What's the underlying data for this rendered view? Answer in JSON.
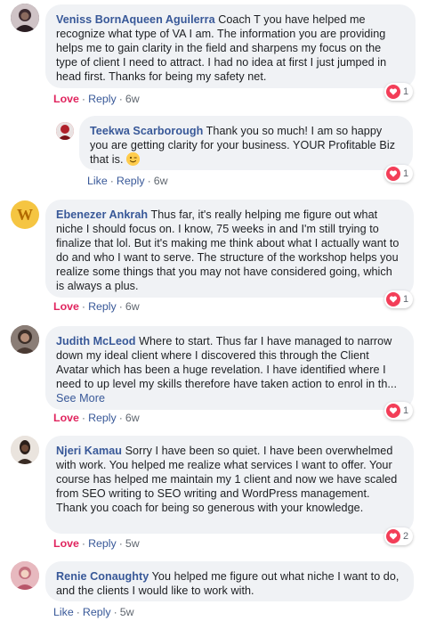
{
  "comments": [
    {
      "author": "Veniss BornAqueen Aguilerra",
      "text": " Coach T you have helped me recognize what type of VA I am. The information you are providing helps me to gain clarity in the field and sharpens my focus on the type of client I need to attract. I had no idea at first I just jumped in head first. Thanks for being my safety net.",
      "reaction_label": "Love",
      "reply_label": "Reply",
      "time": "6w",
      "reaction_count": "1"
    },
    {
      "author": "Teekwa Scarborough",
      "text": " Thank you so much! I am so happy you are getting clarity for your business. YOUR Profitable Biz that is. ",
      "emoji": "winking-face",
      "reaction_label": "Like",
      "reply_label": "Reply",
      "time": "6w",
      "reaction_count": "1"
    },
    {
      "author": "Ebenezer Ankrah",
      "avatar_letter": "W",
      "text": " Thus far, it's really helping me figure out what niche I should focus on. I know, 75 weeks in and I'm still trying to finalize that lol. But it's making me think about what I actually want to do and who I want to serve. The structure of the workshop helps you realize some things that you may not have considered going, which is always a plus.",
      "reaction_label": "Love",
      "reply_label": "Reply",
      "time": "6w",
      "reaction_count": "1"
    },
    {
      "author": "Judith McLeod",
      "text": " Where to start. Thus far I have managed to narrow down my ideal client where I discovered this through the Client Avatar which has been a huge revelation. I have identified where I need to up level my skills therefore have taken action to enrol in th... ",
      "see_more": "See More",
      "reaction_label": "Love",
      "reply_label": "Reply",
      "time": "6w",
      "reaction_count": "1"
    },
    {
      "author": "Njeri Kamau",
      "text": " Sorry I have been so quiet. I have been overwhelmed with work. You helped me realize what services I want to offer. Your course has helped me maintain my 1 client and now we have scaled from SEO writing to SEO writing and WordPress management. Thank you coach for being so generous with your knowledge.",
      "reaction_label": "Love",
      "reply_label": "Reply",
      "time": "5w",
      "reaction_count": "2"
    },
    {
      "author": "Renie Conaughty",
      "text": " You helped me figure out what niche I want to do, and the clients I would like to work with.",
      "reaction_label": "Like",
      "reply_label": "Reply",
      "time": "5w"
    }
  ],
  "separator": "·",
  "colors": {
    "author_link": "#385898",
    "love": "#e0245e",
    "bubble": "#f0f2f5",
    "heart_badge": "#f33e58",
    "meta_text": "#606770"
  }
}
